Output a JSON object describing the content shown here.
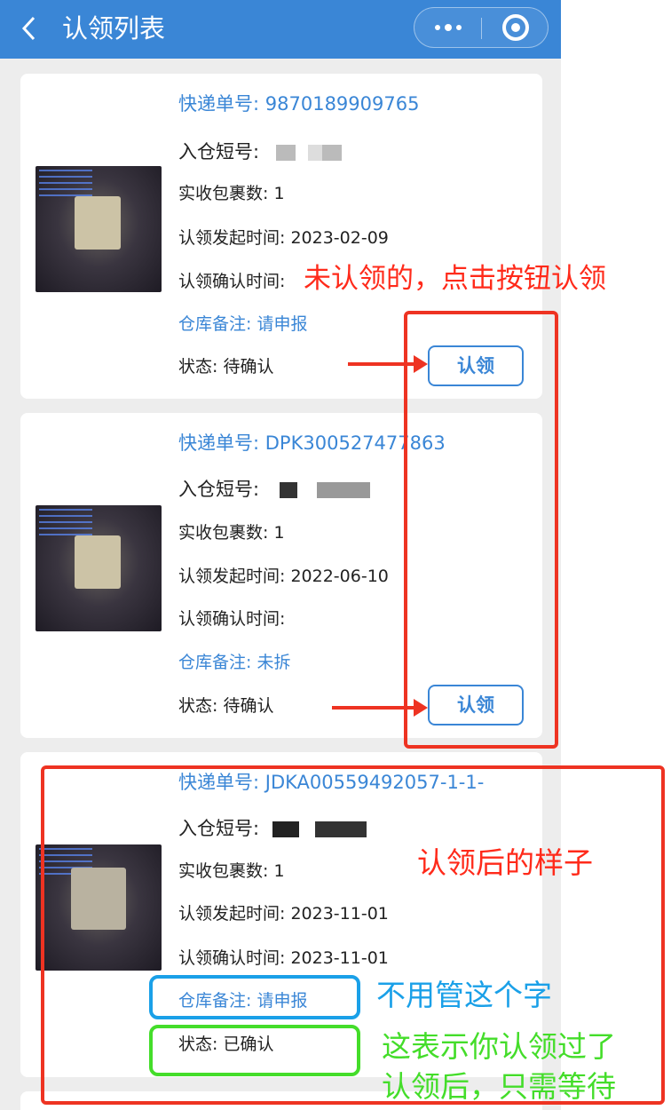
{
  "nav": {
    "back_icon": "chevron-left-icon",
    "title": "认领列表"
  },
  "labels": {
    "tracking": "快递单号: ",
    "short_no": "入仓短号: ",
    "packages": "实收包裹数: ",
    "start_time": "认领发起时间: ",
    "confirm_time": "认领确认时间: ",
    "remark": "仓库备注: ",
    "status": "状态: "
  },
  "cards": [
    {
      "tracking": "9870189909765",
      "packages": "1",
      "start_time": "2023-02-09",
      "confirm_time": "",
      "remark": "请申报",
      "status": "待确认",
      "button": "认领"
    },
    {
      "tracking": "DPK300527477863",
      "packages": "1",
      "start_time": "2022-06-10",
      "confirm_time": "",
      "remark": "未拆",
      "status": "待确认",
      "button": "认领"
    },
    {
      "tracking": "JDKA00559492057-1-1-",
      "packages": "1",
      "start_time": "2023-11-01",
      "confirm_time": "2023-11-01",
      "remark": "请申报",
      "status": "已确认"
    }
  ],
  "annotations": {
    "unclaimed": "未认领的，点击按钮认领",
    "after_claim": "认领后的样子",
    "ignore": "不用管这个字",
    "claimed_line1": "这表示你认领过了",
    "claimed_line2": "认领后，只需等待"
  },
  "colors": {
    "brand": "#3a86d6",
    "annotation_red": "#ff2a1a",
    "annotation_blue": "#1aa0e8",
    "annotation_green": "#44dd2a"
  }
}
